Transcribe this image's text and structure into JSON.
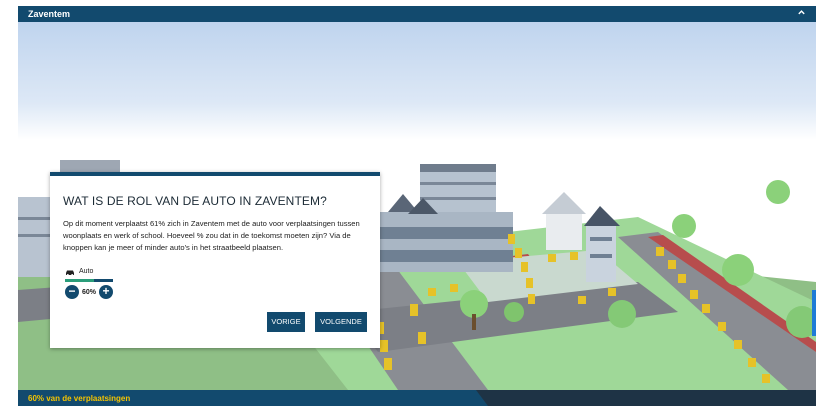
{
  "header": {
    "title": "Zaventem",
    "collapse_icon": "chevron-up-icon"
  },
  "dialog": {
    "title": "WAT IS DE ROL VAN DE AUTO IN ZAVENTEM?",
    "body": "Op dit moment verplaatst 61% zich in Zaventem met de auto voor verplaatsingen tussen woonplaats en werk of school. Hoeveel % zou dat in de toekomst moeten zijn? Via de knoppen kan je meer of minder auto's in het straatbeeld plaatsen.",
    "mode_label": "Auto",
    "mode_icon": "car-icon",
    "share_fraction": 0.6,
    "percent_label": "60%",
    "decrease_symbol": "−",
    "increase_symbol": "+",
    "prev_label": "VORIGE",
    "next_label": "VOLGENDE"
  },
  "footer": {
    "status": "60% van de verplaatsingen"
  },
  "colors": {
    "primary": "#124a6e",
    "accent_yellow": "#f5c400",
    "progress_green": "#2a9d7a"
  }
}
